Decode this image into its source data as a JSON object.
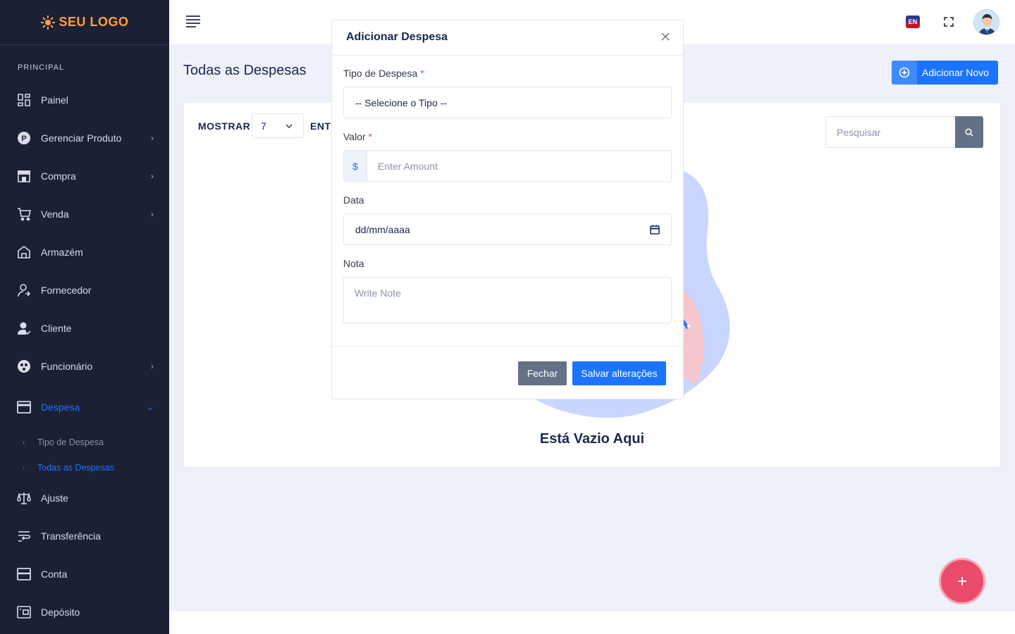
{
  "brand": {
    "logo_text": "SEU LOGO"
  },
  "sidebar": {
    "section_label": "PRINCIPAL",
    "items": [
      {
        "label": "Painel",
        "icon": "dashboard-icon",
        "has_children": false
      },
      {
        "label": "Gerenciar Produto",
        "icon": "product-icon",
        "has_children": true
      },
      {
        "label": "Compra",
        "icon": "store-icon",
        "has_children": true
      },
      {
        "label": "Venda",
        "icon": "cart-icon",
        "has_children": true
      },
      {
        "label": "Armazém",
        "icon": "warehouse-icon",
        "has_children": false
      },
      {
        "label": "Fornecedor",
        "icon": "supplier-icon",
        "has_children": false
      },
      {
        "label": "Cliente",
        "icon": "customer-icon",
        "has_children": false
      },
      {
        "label": "Funcionário",
        "icon": "employee-icon",
        "has_children": true
      },
      {
        "label": "Despesa",
        "icon": "expense-icon",
        "has_children": true,
        "active": true
      },
      {
        "label": "Ajuste",
        "icon": "adjust-icon",
        "has_children": false
      },
      {
        "label": "Transferência",
        "icon": "transfer-icon",
        "has_children": false
      },
      {
        "label": "Conta",
        "icon": "account-icon",
        "has_children": false
      },
      {
        "label": "Depósito",
        "icon": "deposit-icon",
        "has_children": false
      }
    ],
    "sub_items": [
      {
        "label": "Tipo de Despesa",
        "active": false
      },
      {
        "label": "Todas as Despesas",
        "active": true
      }
    ]
  },
  "header": {
    "language_badge": "EN"
  },
  "page": {
    "title": "Todas as Despesas",
    "add_new_label": "Adicionar Novo",
    "show_label": "MOSTRAR",
    "show_value": "7",
    "entries_label": "ENTI",
    "search_placeholder": "Pesquisar",
    "empty_text": "Está Vazio Aqui"
  },
  "modal": {
    "title": "Adicionar Despesa",
    "type_label": "Tipo de Despesa",
    "type_required_mark": "*",
    "type_value": "-- Selecione o Tipo --",
    "amount_label": "Valor",
    "amount_required_mark": "*",
    "currency_prefix": "$",
    "amount_placeholder": "Enter Amount",
    "date_label": "Data",
    "date_placeholder": "dd/mm/aaaa",
    "note_label": "Nota",
    "note_placeholder": "Write Note",
    "close_button": "Fechar",
    "save_button": "Salvar alterações"
  },
  "colors": {
    "sidebar_bg": "#1b2034",
    "accent": "#1b74ff",
    "logo": "#ff9f43",
    "fab": "#ea4b6b",
    "secondary_button": "#647086"
  }
}
